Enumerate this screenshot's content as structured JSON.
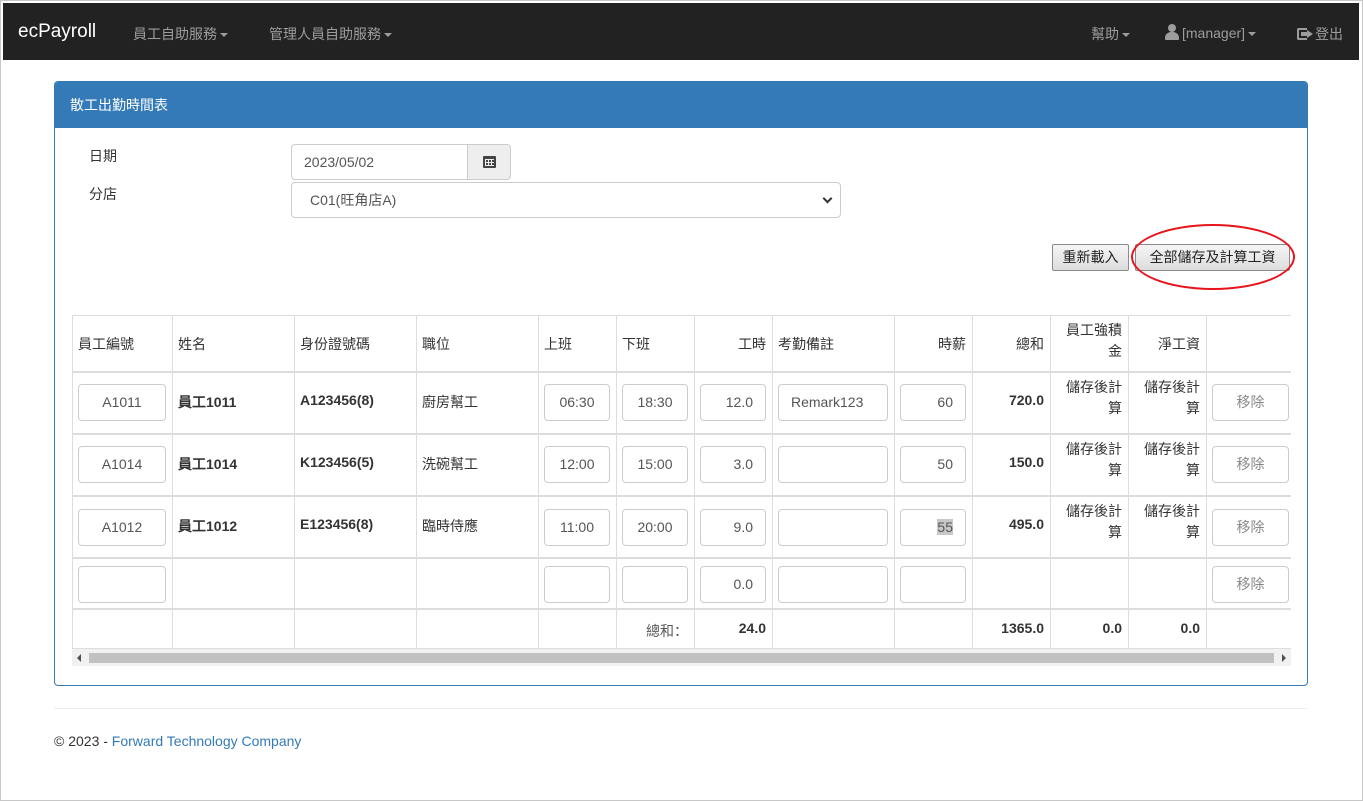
{
  "navbar": {
    "brand": "ecPayroll",
    "menu_employee": "員工自助服務",
    "menu_manager": "管理人員自助服務",
    "help": "幫助",
    "user": "[manager]",
    "logout": "登出"
  },
  "panel": {
    "title": "散工出勤時間表"
  },
  "form": {
    "date_label": "日期",
    "date_value": "2023/05/02",
    "branch_label": "分店",
    "branch_value": "C01(旺角店A)"
  },
  "buttons": {
    "reload": "重新載入",
    "save_all": "全部儲存及計算工資"
  },
  "table": {
    "headers": {
      "emp_no": "員工編號",
      "name": "姓名",
      "id_no": "身份證號碼",
      "position": "職位",
      "start": "上班",
      "end": "下班",
      "hours": "工時",
      "remark": "考勤備註",
      "rate": "時薪",
      "total": "總和",
      "mpf_line1": "員工強積",
      "mpf_line2": "金",
      "net": "淨工資"
    },
    "rows": [
      {
        "emp_no": "A1011",
        "name": "員工1011",
        "id_no": "A123456(8)",
        "position": "廚房幫工",
        "start": "06:30",
        "end": "18:30",
        "hours": "12.0",
        "remark": "Remark123",
        "rate": "60",
        "total": "720.0",
        "mpf_line1": "儲存後計",
        "mpf_line2": "算",
        "net_line1": "儲存後計",
        "net_line2": "算",
        "remove": "移除"
      },
      {
        "emp_no": "A1014",
        "name": "員工1014",
        "id_no": "K123456(5)",
        "position": "洗碗幫工",
        "start": "12:00",
        "end": "15:00",
        "hours": "3.0",
        "remark": "",
        "rate": "50",
        "total": "150.0",
        "mpf_line1": "儲存後計",
        "mpf_line2": "算",
        "net_line1": "儲存後計",
        "net_line2": "算",
        "remove": "移除"
      },
      {
        "emp_no": "A1012",
        "name": "員工1012",
        "id_no": "E123456(8)",
        "position": "臨時侍應",
        "start": "11:00",
        "end": "20:00",
        "hours": "9.0",
        "remark": "",
        "rate": "55",
        "total": "495.0",
        "mpf_line1": "儲存後計",
        "mpf_line2": "算",
        "net_line1": "儲存後計",
        "net_line2": "算",
        "remove": "移除"
      }
    ],
    "new_row": {
      "hours": "0.0",
      "remove": "移除"
    },
    "footer": {
      "label": "總和：",
      "hours_sum": "24.0",
      "total_sum": "1365.0",
      "mpf_sum": "0.0",
      "net_sum": "0.0"
    }
  },
  "footer": {
    "copyright": "© 2023 - ",
    "company": "Forward Technology Company"
  },
  "colors": {
    "navbar_bg": "#222222",
    "panel_primary": "#337ab7",
    "highlight_circle": "#e8141b"
  }
}
